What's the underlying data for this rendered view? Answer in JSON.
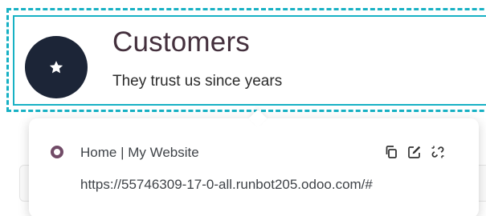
{
  "snippet": {
    "heading": "Customers",
    "subheading": "They trust us since years",
    "badge_icon": "star-icon",
    "badge_color": "#1c2537",
    "selection_color": "#17b1c4"
  },
  "link_popover": {
    "page_icon": "page-circle-icon",
    "page_title": "Home | My Website",
    "url": "https://55746309-17-0-all.runbot205.odoo.com/#",
    "actions": [
      {
        "name": "copy-link",
        "icon": "copy-icon"
      },
      {
        "name": "edit-link",
        "icon": "edit-icon"
      },
      {
        "name": "remove-link",
        "icon": "unlink-icon"
      }
    ],
    "accent_color": "#714b67"
  }
}
